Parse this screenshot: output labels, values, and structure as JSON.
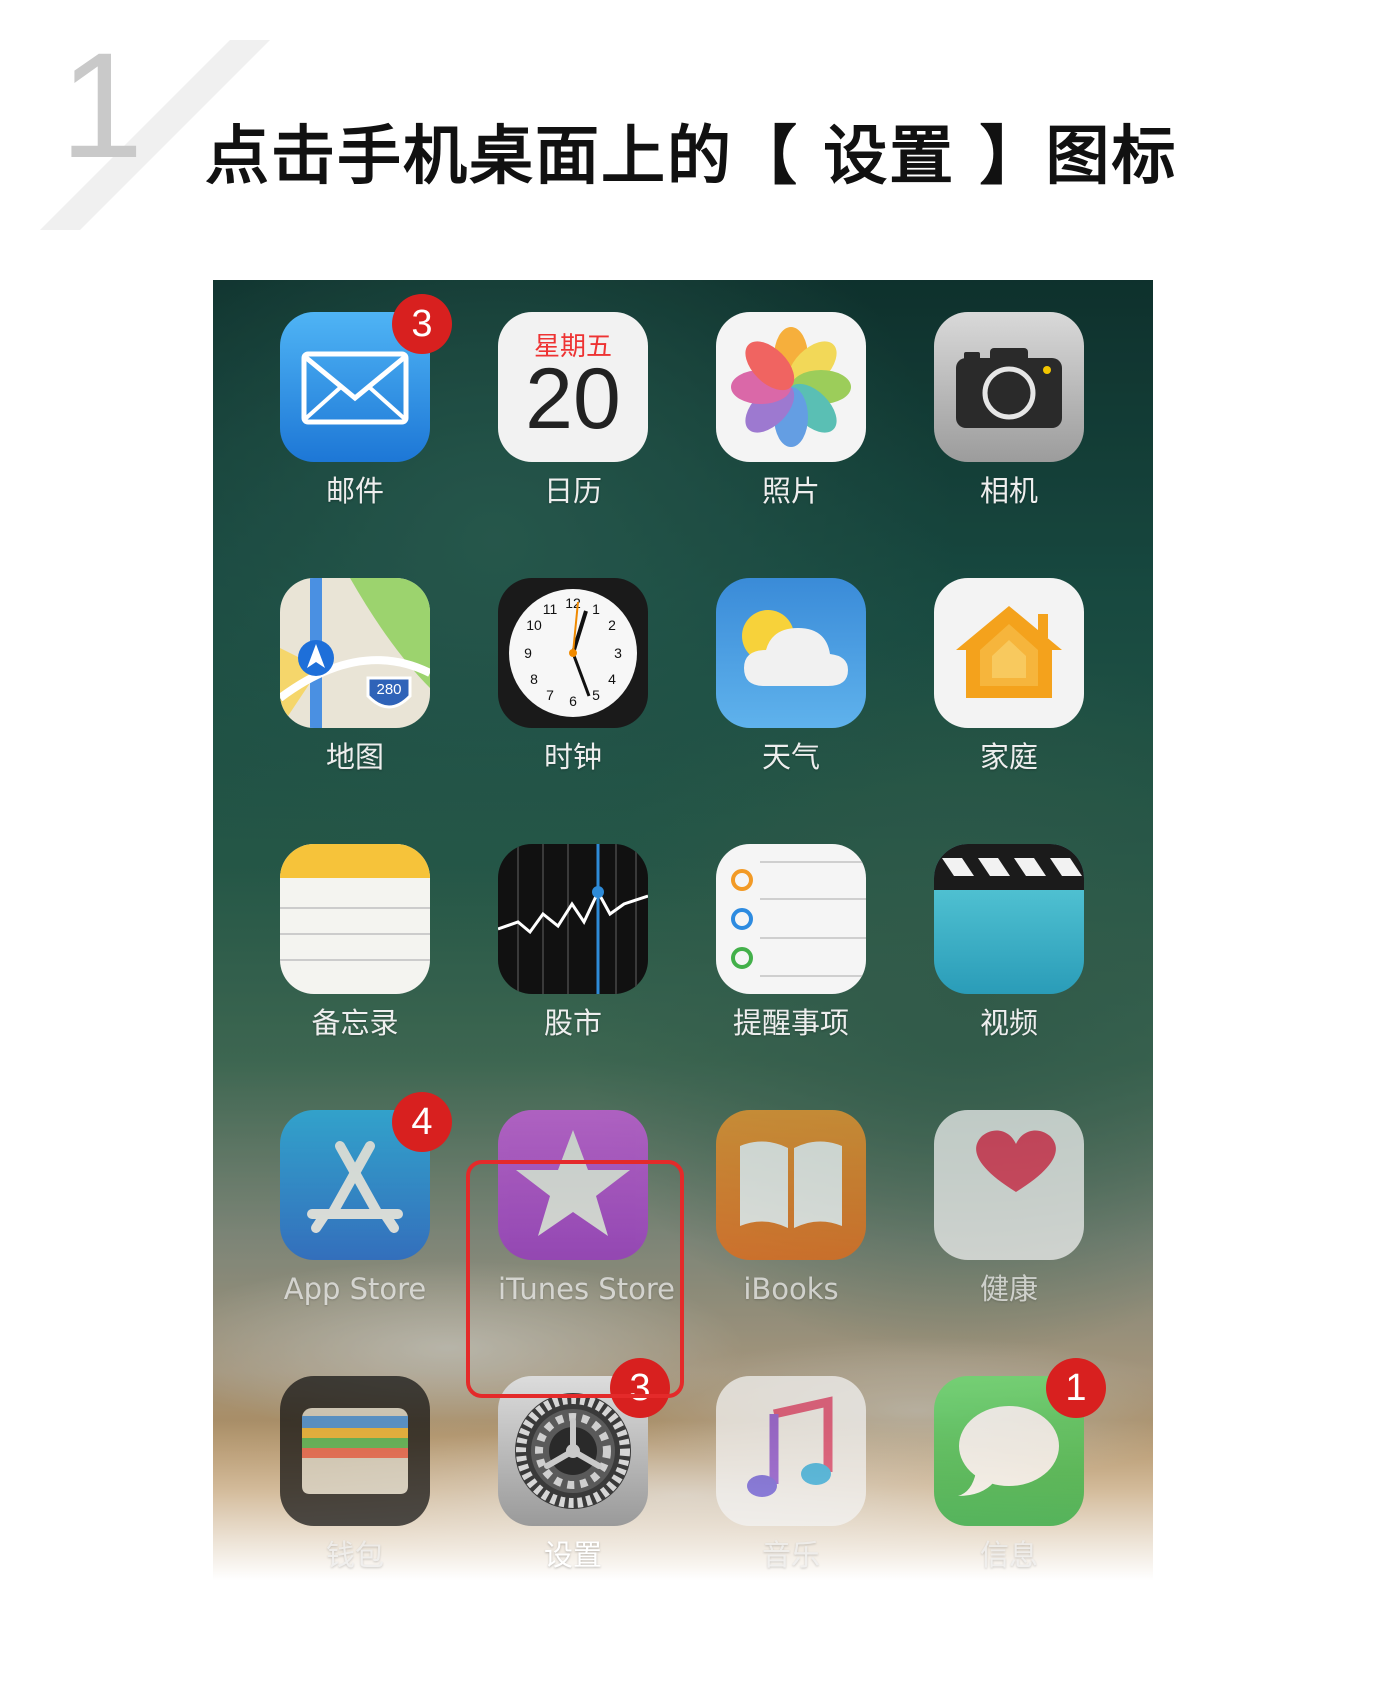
{
  "step": {
    "number": "1",
    "title": "点击手机桌面上的【 设置 】图标"
  },
  "calendar": {
    "weekday": "星期五",
    "day": "20"
  },
  "maps_shield": "280",
  "apps": [
    {
      "label": "邮件",
      "badge": "3"
    },
    {
      "label": "日历"
    },
    {
      "label": "照片"
    },
    {
      "label": "相机"
    },
    {
      "label": "地图"
    },
    {
      "label": "时钟"
    },
    {
      "label": "天气"
    },
    {
      "label": "家庭"
    },
    {
      "label": "备忘录"
    },
    {
      "label": "股市"
    },
    {
      "label": "提醒事项"
    },
    {
      "label": "视频"
    },
    {
      "label": "App Store",
      "badge": "4"
    },
    {
      "label": "iTunes Store"
    },
    {
      "label": "iBooks"
    },
    {
      "label": "健康"
    },
    {
      "label": "钱包"
    },
    {
      "label": "设置",
      "badge": "3"
    },
    {
      "label": "音乐"
    },
    {
      "label": "信息",
      "badge": "1"
    }
  ],
  "colors": {
    "highlight": "#e42a2a",
    "badge": "#d8201f"
  }
}
